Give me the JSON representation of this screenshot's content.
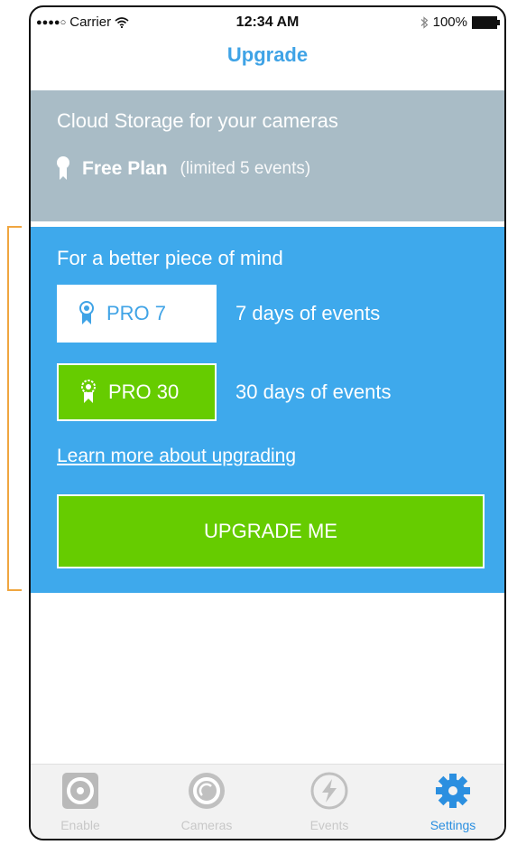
{
  "status_bar": {
    "carrier": "Carrier",
    "time": "12:34 AM",
    "battery": "100%"
  },
  "nav": {
    "title": "Upgrade"
  },
  "cloud": {
    "title": "Cloud Storage for your cameras",
    "plan_name": "Free Plan",
    "plan_note": "(limited 5 events)"
  },
  "upgrade": {
    "heading": "For a better piece of mind",
    "plans": [
      {
        "label": "PRO 7",
        "desc": "7 days of events"
      },
      {
        "label": "PRO 30",
        "desc": "30 days of events"
      }
    ],
    "learn_more": "Learn more about upgrading",
    "cta": "UPGRADE ME"
  },
  "tabs": [
    {
      "label": "Enable",
      "icon": "enable-icon"
    },
    {
      "label": "Cameras",
      "icon": "camera-icon"
    },
    {
      "label": "Events",
      "icon": "lightning-icon"
    },
    {
      "label": "Settings",
      "icon": "gear-icon",
      "active": true
    }
  ],
  "colors": {
    "accent_blue": "#3ea9ec",
    "green": "#66cc00",
    "grey_section": "#a9bcc6",
    "annotation_orange": "#f0a640"
  }
}
